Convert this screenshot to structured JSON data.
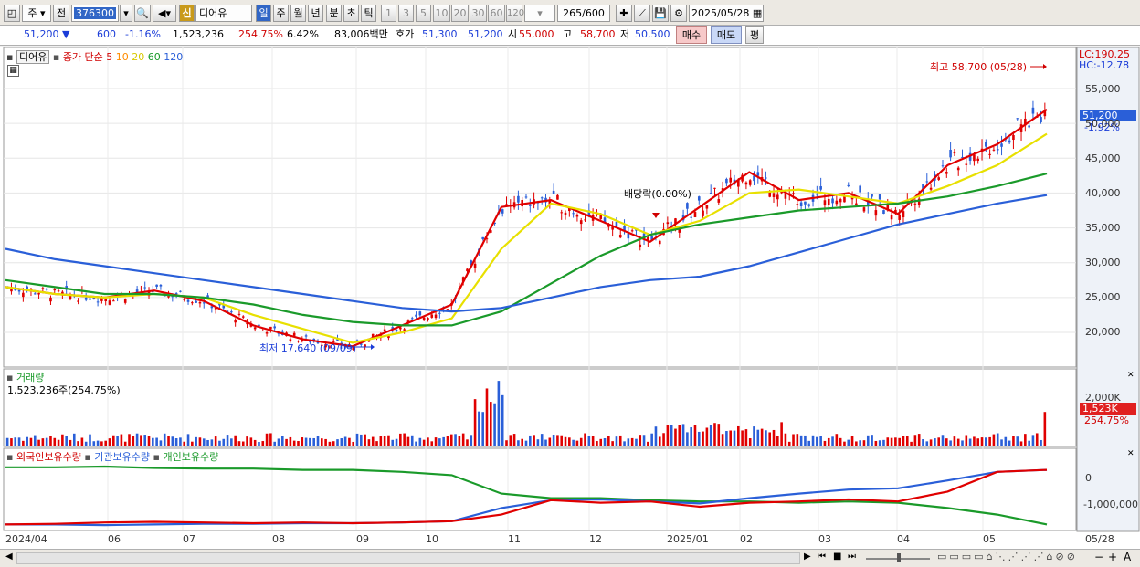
{
  "toolbar": {
    "period_main": "주",
    "prev": "전",
    "code": "376300",
    "credit_badge": "신",
    "stock_name": "디어유",
    "period_tabs": [
      "일",
      "주",
      "월",
      "년",
      "분",
      "초",
      "틱"
    ],
    "intervals": [
      "1",
      "3",
      "5",
      "10",
      "20",
      "30",
      "60",
      "120"
    ],
    "count_value": "265",
    "count_max": "/600",
    "date": "2025/05/28"
  },
  "quote": {
    "price": "51,200",
    "change": "600",
    "change_pct": "-1.16%",
    "volume": "1,523,236",
    "volume_ratio": "254.75%",
    "turnover": "6.42%",
    "amount": "83,006백만",
    "ask_label": "호가",
    "ask": "51,300",
    "bid": "51,200",
    "open_label": "시",
    "open": "55,000",
    "high_label": "고",
    "high": "58,700",
    "low_label": "저",
    "low": "50,500",
    "buy_label": "매수",
    "sell_label": "매도",
    "flat_label": "평"
  },
  "price_panel": {
    "name_tag": "디어유",
    "ma_title": "종가 단순",
    "ma_periods": [
      "5",
      "10",
      "20",
      "60",
      "120"
    ],
    "ma_colors": [
      "#e00000",
      "#ff8c00",
      "#e8e000",
      "#1a9a2a",
      "#2a5fd8"
    ],
    "lc": "LC:190.25",
    "hc": "HC:-12.78",
    "high_note": "최고 58,700 (05/28)",
    "low_note": "최저 17,640 (09/09)",
    "dividend_note": "배당락(0.00%)",
    "current_price": "51,200",
    "current_pct": "-1.92%",
    "y_ticks": [
      "55,000",
      "50,000",
      "45,000",
      "40,000",
      "35,000",
      "30,000",
      "25,000",
      "20,000"
    ]
  },
  "volume_panel": {
    "title": "거래량",
    "value": "1,523,236주(254.75%)",
    "tick": "2,000K",
    "current": "1,523K",
    "current_pct": "254.75%"
  },
  "holding_panel": {
    "series": [
      "외국인보유수량",
      "기관보유수량",
      "개인보유수량"
    ],
    "colors": [
      "#e00000",
      "#2a5fd8",
      "#1a9a2a"
    ],
    "ticks": [
      "0",
      "-1,000,000"
    ]
  },
  "x_axis": {
    "labels": [
      "2024/04",
      "06",
      "07",
      "08",
      "09",
      "10",
      "11",
      "12",
      "2025/01",
      "02",
      "03",
      "04",
      "05"
    ],
    "end_label": "05/28"
  },
  "chart_data": {
    "type": "line",
    "title": "",
    "series": [
      {
        "name": "5",
        "values": [
          26500,
          25500,
          25000,
          26000,
          24500,
          21000,
          19000,
          18000,
          21000,
          24000,
          38000,
          39000,
          36000,
          33000,
          38000,
          43000,
          39000,
          40000,
          37000,
          44000,
          47000,
          52000
        ]
      },
      {
        "name": "20",
        "values": [
          26500,
          25500,
          25000,
          25500,
          25000,
          22500,
          20500,
          18500,
          20000,
          22000,
          32000,
          38500,
          37000,
          34000,
          36000,
          40000,
          40500,
          39500,
          38500,
          41000,
          44000,
          48500
        ]
      },
      {
        "name": "60",
        "values": [
          27500,
          26500,
          25500,
          25500,
          25000,
          24000,
          22500,
          21500,
          21000,
          21000,
          23000,
          27000,
          31000,
          34000,
          35500,
          36500,
          37500,
          38000,
          38500,
          39500,
          41000,
          42800
        ]
      },
      {
        "name": "120",
        "values": [
          32000,
          30500,
          29500,
          28500,
          27500,
          26500,
          25500,
          24500,
          23500,
          23000,
          23500,
          25000,
          26500,
          27500,
          28000,
          29500,
          31500,
          33500,
          35500,
          37000,
          38500,
          39700
        ]
      }
    ],
    "ylim": [
      17000,
      59000
    ]
  }
}
